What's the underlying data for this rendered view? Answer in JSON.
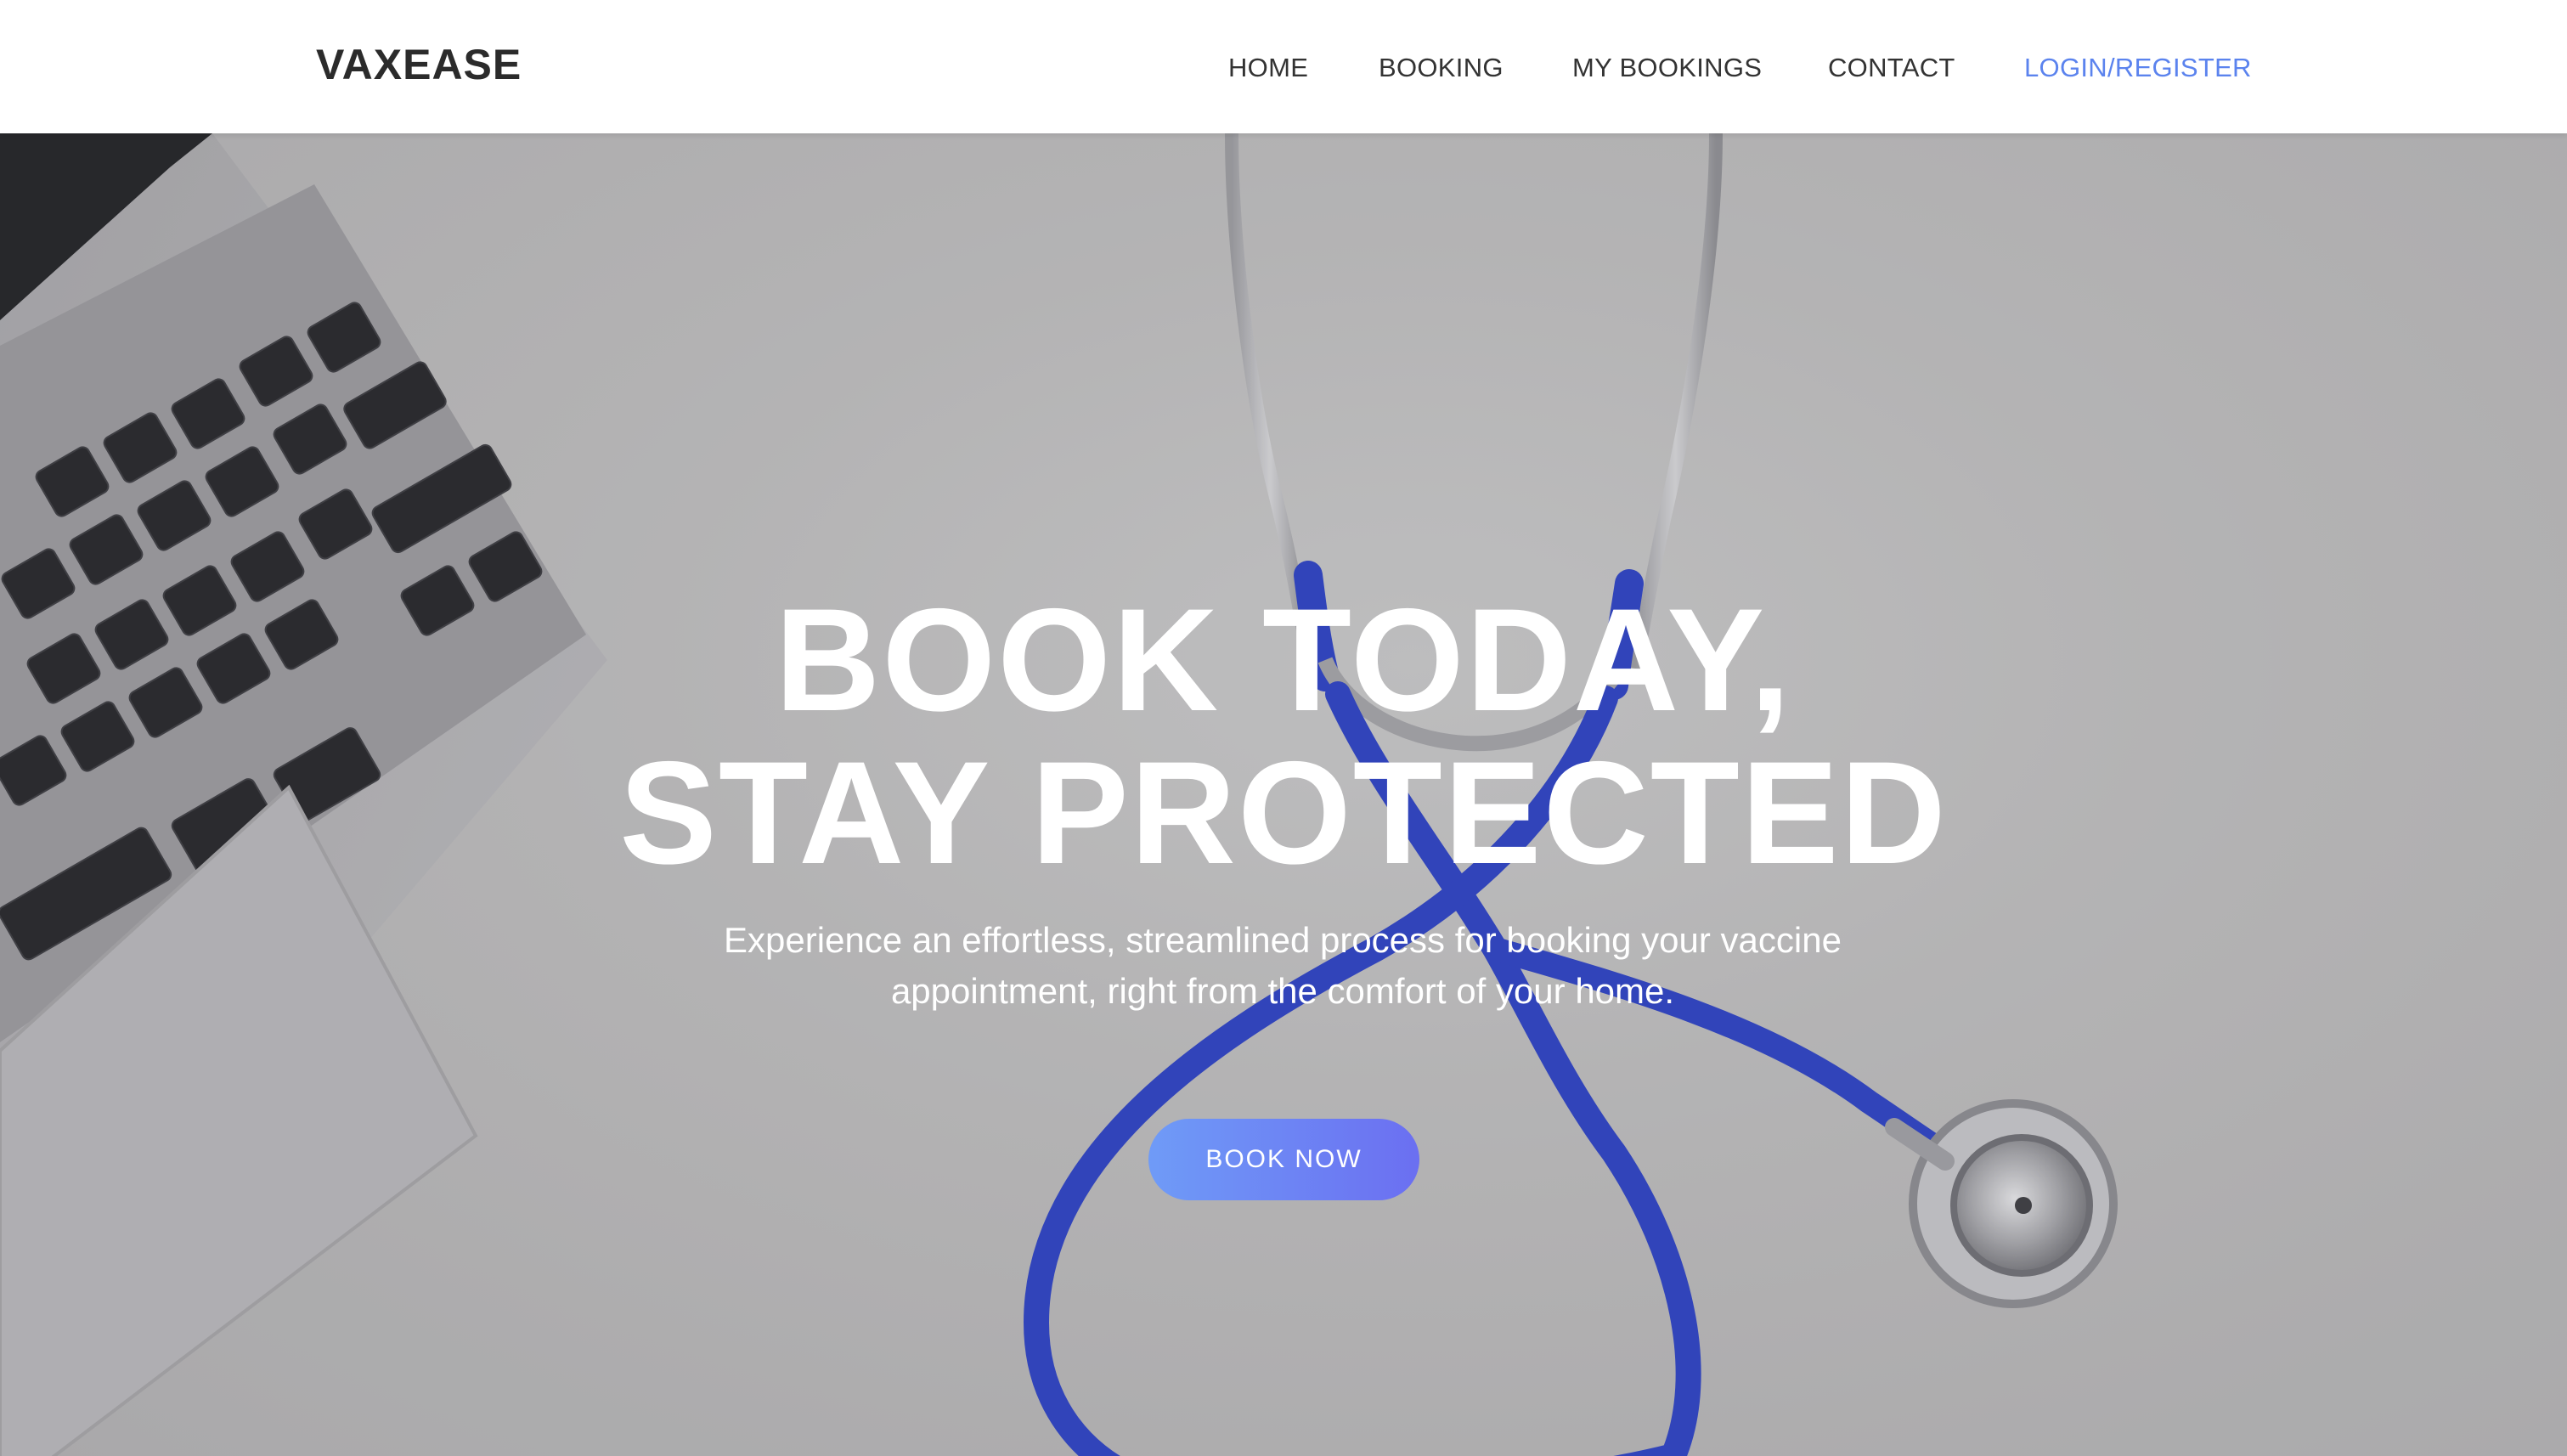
{
  "header": {
    "brand": "VAXEASE",
    "nav": [
      {
        "label": "HOME"
      },
      {
        "label": "BOOKING"
      },
      {
        "label": "MY BOOKINGS"
      },
      {
        "label": "CONTACT"
      },
      {
        "label": "LOGIN/REGISTER"
      }
    ]
  },
  "hero": {
    "headline_line1": "BOOK TODAY,",
    "headline_line2": "STAY PROTECTED",
    "subtext": "Experience an effortless, streamlined process for booking your vaccine appointment, right from the comfort of your home.",
    "cta_label": "BOOK NOW",
    "background_image": "laptop and blue stethoscope on white desk"
  },
  "colors": {
    "accent_link": "#5b83ee",
    "cta_gradient_start": "#6f9bf7",
    "cta_gradient_end": "#6b6ff1",
    "stethoscope_blue": "#2a3fc4"
  },
  "icons": {
    "laptop": "laptop-image",
    "stethoscope": "stethoscope-image"
  }
}
